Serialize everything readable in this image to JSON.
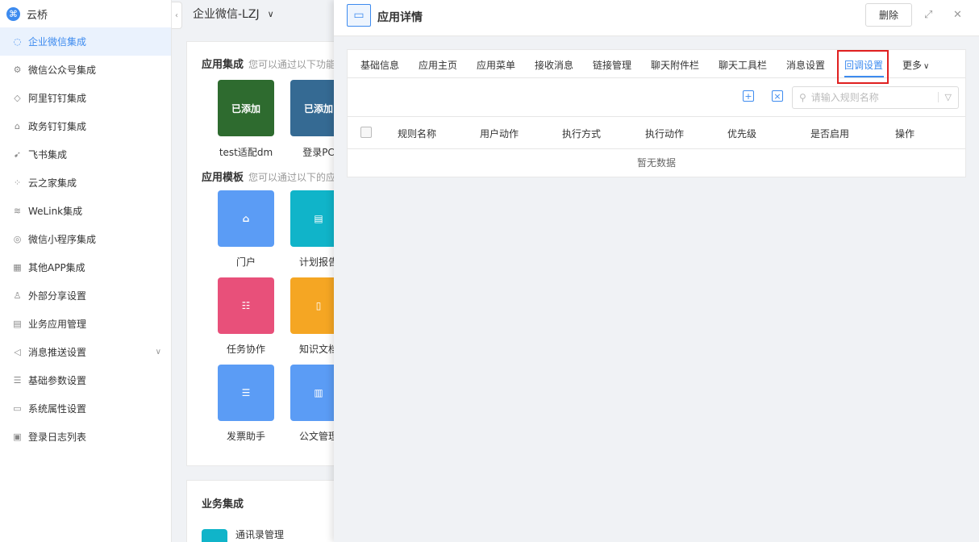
{
  "sidebar": {
    "brand": "云桥",
    "items": [
      {
        "label": "企业微信集成",
        "icon": "chat-icon",
        "glyph": "◌"
      },
      {
        "label": "微信公众号集成",
        "icon": "gear-icon",
        "glyph": "⚙"
      },
      {
        "label": "阿里钉钉集成",
        "icon": "tag-icon",
        "glyph": "◇"
      },
      {
        "label": "政务钉钉集成",
        "icon": "building-icon",
        "glyph": "⌂"
      },
      {
        "label": "飞书集成",
        "icon": "plane-icon",
        "glyph": "➹"
      },
      {
        "label": "云之家集成",
        "icon": "share-icon",
        "glyph": "⁘"
      },
      {
        "label": "WeLink集成",
        "icon": "layers-icon",
        "glyph": "≋"
      },
      {
        "label": "微信小程序集成",
        "icon": "miniprogram-icon",
        "glyph": "◎"
      },
      {
        "label": "其他APP集成",
        "icon": "app-icon",
        "glyph": "▦"
      },
      {
        "label": "外部分享设置",
        "icon": "user-icon",
        "glyph": "♙"
      },
      {
        "label": "业务应用管理",
        "icon": "grid-icon",
        "glyph": "▤"
      },
      {
        "label": "消息推送设置",
        "icon": "send-icon",
        "glyph": "◁"
      },
      {
        "label": "基础参数设置",
        "icon": "sliders-icon",
        "glyph": "☰"
      },
      {
        "label": "系统属性设置",
        "icon": "window-icon",
        "glyph": "▭"
      },
      {
        "label": "登录日志列表",
        "icon": "log-icon",
        "glyph": "▣"
      }
    ]
  },
  "topbar": {
    "org": "企业微信-LZJ"
  },
  "background": {
    "app_integration": {
      "title": "应用集成",
      "subtitle": "您可以通过以下功能"
    },
    "apps": [
      {
        "badge": "已添加",
        "label": "test适配dm",
        "color": "#2e6b2f"
      },
      {
        "badge": "已添加",
        "label": "登录PC",
        "color": "#356a93"
      }
    ],
    "app_templates": {
      "title": "应用模板",
      "subtitle": "您可以通过以下的应"
    },
    "templates": [
      {
        "label": "门户",
        "color": "#5b9cf5",
        "icon": "home-icon"
      },
      {
        "label": "计划报告",
        "color": "#10b4c9",
        "icon": "report-icon"
      },
      {
        "label": "任务协作",
        "color": "#e8507a",
        "icon": "list-icon"
      },
      {
        "label": "知识文档",
        "color": "#f5a623",
        "icon": "document-icon"
      },
      {
        "label": "发票助手",
        "color": "#5b9cf5",
        "icon": "receipt-icon"
      },
      {
        "label": "公文管理",
        "color": "#5b9cf5",
        "icon": "briefcase-icon"
      }
    ],
    "business": {
      "title": "业务集成",
      "item": "通讯录管理"
    }
  },
  "panel": {
    "title": "应用详情",
    "delete_label": "删除",
    "tabs": [
      "基础信息",
      "应用主页",
      "应用菜单",
      "接收消息",
      "链接管理",
      "聊天附件栏",
      "聊天工具栏",
      "消息设置",
      "回调设置",
      "更多"
    ],
    "active_tab": "回调设置",
    "search_placeholder": "请输入规则名称",
    "columns": [
      "规则名称",
      "用户动作",
      "执行方式",
      "执行动作",
      "优先级",
      "是否启用",
      "操作"
    ],
    "empty_text": "暂无数据"
  },
  "colors": {
    "accent": "#3d8bef",
    "highlight": "#e02020"
  }
}
